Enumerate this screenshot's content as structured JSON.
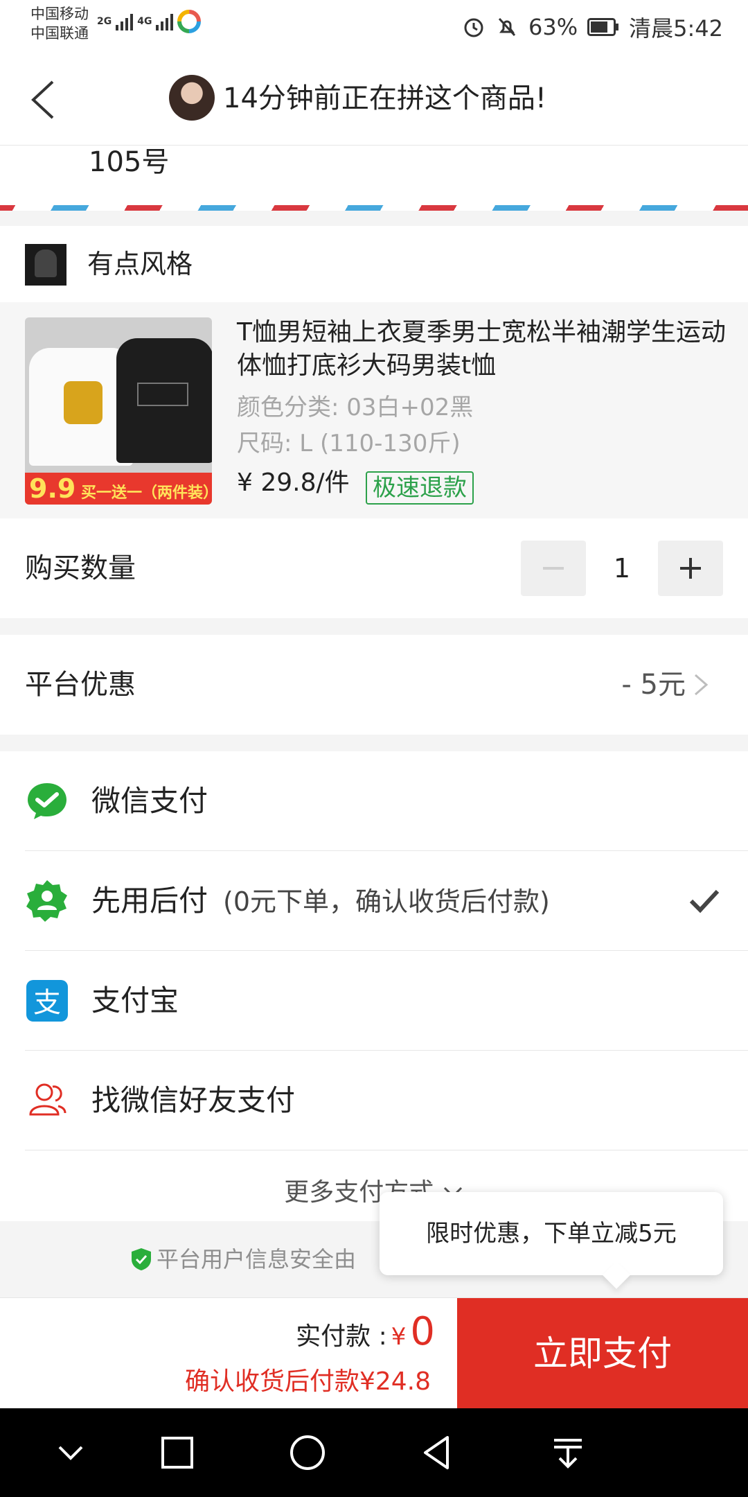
{
  "status_bar": {
    "carrier1": "中国移动",
    "carrier2": "中国联通",
    "net1": "2G",
    "net2": "4G",
    "battery": "63%",
    "time": "清晨5:42"
  },
  "header": {
    "title": "14分钟前正在拼这个商品!"
  },
  "address": {
    "text": "105号"
  },
  "store": {
    "name": "有点风格"
  },
  "product": {
    "title": "T恤男短袖上衣夏季男士宽松半袖潮学生运动体恤打底衫大码男装t恤",
    "color": "颜色分类: 03白+02黑",
    "size": "尺码: L (110-130斤)",
    "price": "¥ 29.8/件",
    "refund_tag": "极速退款",
    "badge_price": "9.9",
    "badge_text": "买一送一（两件装）"
  },
  "quantity": {
    "label": "购买数量",
    "value": "1"
  },
  "discount": {
    "label": "平台优惠",
    "value": "- 5元"
  },
  "payment": {
    "options": [
      {
        "label": "微信支付"
      },
      {
        "label": "先用后付",
        "sub": "(0元下单，确认收货后付款)",
        "selected": true
      },
      {
        "label": "支付宝"
      },
      {
        "label": "找微信好友支付"
      }
    ],
    "more": "更多支付方式"
  },
  "security": {
    "text": "平台用户信息安全由"
  },
  "tooltip": {
    "text": "限时优惠，下单立减5元"
  },
  "paybar": {
    "paid_label": "实付款 :",
    "currency": "¥",
    "paid_amount": "0",
    "after_note": "确认收货后付款¥24.8",
    "button": "立即支付"
  },
  "colors": {
    "accent_red": "#e02e24",
    "green": "#2ca14a",
    "wechat": "#2aae3b",
    "alipay": "#1296db"
  }
}
